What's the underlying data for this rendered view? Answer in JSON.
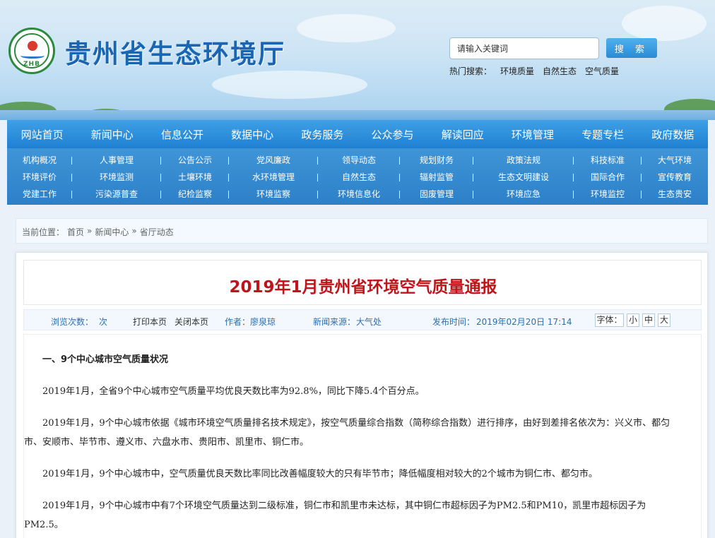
{
  "header": {
    "emblem_abbr": "ZHB",
    "site_title": "贵州省生态环境厅",
    "search_placeholder": "请输入关键词",
    "search_button": "搜 索",
    "hot_label": "热门搜索：",
    "hot_terms": [
      "环境质量",
      "自然生态",
      "空气质量"
    ]
  },
  "nav": [
    "网站首页",
    "新闻中心",
    "信息公开",
    "数据中心",
    "政务服务",
    "公众参与",
    "解读回应",
    "环境管理",
    "专题专栏",
    "政府数据"
  ],
  "submenu": [
    [
      "机构概况",
      "人事管理",
      "公告公示",
      "党风廉政",
      "领导动态",
      "规划财务",
      "政策法规",
      "科技标准",
      "大气环境"
    ],
    [
      "环境评价",
      "环境监测",
      "土壤环境",
      "水环境管理",
      "自然生态",
      "辐射监管",
      "生态文明建设",
      "国际合作",
      "宣传教育"
    ],
    [
      "党建工作",
      "污染源普查",
      "纪检监察",
      "环境监察",
      "环境信息化",
      "固废管理",
      "环境应急",
      "环境监控",
      "生态贵安"
    ]
  ],
  "breadcrumb": {
    "label": "当前位置：",
    "items": [
      "首页",
      "»",
      "新闻中心",
      "»",
      "省厅动态"
    ]
  },
  "article": {
    "title": "2019年1月贵州省环境空气质量通报",
    "meta": {
      "views_label": "浏览次数：",
      "views_unit": "次",
      "print": "打印本页",
      "close": "关闭本页",
      "author_label": "作者：",
      "author": "廖泉琼",
      "source_label": "新闻来源：",
      "source": "大气处",
      "time_label": "发布时间：",
      "time": "2019年02月20日 17:14",
      "font_label": "字体：",
      "font_small": "小",
      "font_medium": "中",
      "font_large": "大"
    },
    "paragraphs": [
      "一、9个中心城市空气质量状况",
      "2019年1月，全省9个中心城市空气质量平均优良天数比率为92.8%，同比下降5.4个百分点。",
      "2019年1月，9个中心城市依据《城市环境空气质量排名技术规定》，按空气质量综合指数（简称综合指数）进行排序，由好到差排名依次为：兴义市、都匀市、安顺市、毕节市、遵义市、六盘水市、贵阳市、凯里市、铜仁市。",
      "2019年1月，9个中心城市中，空气质量优良天数比率同比改善幅度较大的只有毕节市；降低幅度相对较大的2个城市为铜仁市、都匀市。",
      "2019年1月，9个中心城市中有7个环境空气质量达到二级标准，铜仁市和凯里市未达标，其中铜仁市超标因子为PM2.5和PM10，凯里市超标因子为PM2.5。"
    ]
  }
}
